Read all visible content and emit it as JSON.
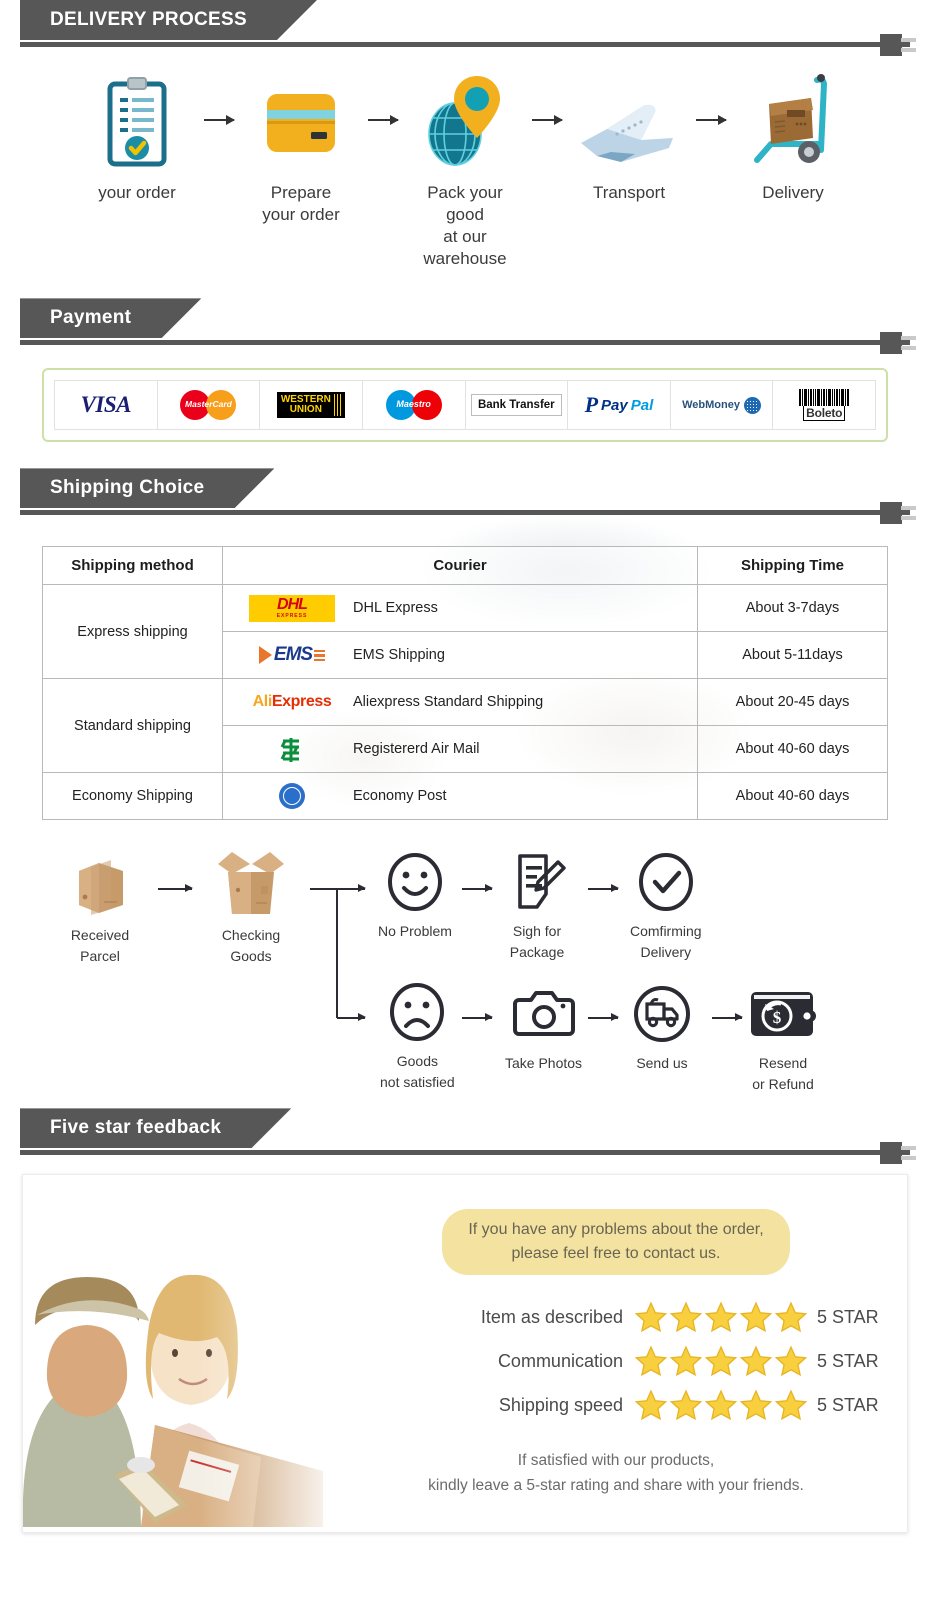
{
  "sections": {
    "delivery_process": {
      "title": "DELIVERY PROCESS"
    },
    "payment": {
      "title": "Payment"
    },
    "shipping_choice": {
      "title": "Shipping Choice"
    },
    "five_star": {
      "title": "Five star feedback"
    }
  },
  "process": {
    "steps": [
      {
        "icon": "clipboard-check-icon",
        "label": "your order"
      },
      {
        "icon": "credit-card-icon",
        "label": "Prepare\nyour order"
      },
      {
        "icon": "globe-location-pin-icon",
        "label": "Pack your good\nat our warehouse"
      },
      {
        "icon": "airplane-icon",
        "label": "Transport"
      },
      {
        "icon": "hand-truck-box-icon",
        "label": "Delivery"
      }
    ],
    "arrow_icon": "arrow-right-icon"
  },
  "payment_methods": [
    {
      "name": "VISA",
      "icon": "visa-logo"
    },
    {
      "name": "MasterCard",
      "icon": "mastercard-logo"
    },
    {
      "name": "WESTERN UNION",
      "icon": "western-union-logo"
    },
    {
      "name": "Maestro",
      "icon": "maestro-logo"
    },
    {
      "name": "Bank Transfer",
      "icon": "bank-transfer-logo"
    },
    {
      "name": "PayPal",
      "icon": "paypal-logo"
    },
    {
      "name": "WebMoney",
      "icon": "webmoney-logo"
    },
    {
      "name": "Boleto",
      "icon": "boleto-logo"
    }
  ],
  "shipping_table": {
    "headers": [
      "Shipping method",
      "Courier",
      "Shipping Time"
    ],
    "rows": [
      {
        "method": "Express shipping",
        "method_rowspan": 2,
        "logo": "dhl-logo",
        "courier": "DHL Express",
        "time": "About 3-7days"
      },
      {
        "method": "",
        "method_rowspan": 0,
        "logo": "ems-logo",
        "courier": "EMS Shipping",
        "time": "About 5-11days"
      },
      {
        "method": "Standard shipping",
        "method_rowspan": 2,
        "logo": "aliexpress-logo",
        "courier": "Aliexpress Standard Shipping",
        "time": "About 20-45 days"
      },
      {
        "method": "",
        "method_rowspan": 0,
        "logo": "china-post-logo",
        "courier": "Registererd Air Mail",
        "time": "About 40-60 days"
      },
      {
        "method": "Economy Shipping",
        "method_rowspan": 1,
        "logo": "un-post-logo",
        "courier": "Economy Post",
        "time": "About 40-60 days"
      }
    ]
  },
  "flow": {
    "start": [
      {
        "icon": "closed-parcel-icon",
        "label": "Received\nParcel"
      },
      {
        "icon": "open-box-icon",
        "label": "Checking\nGoods"
      }
    ],
    "happy_path": [
      {
        "icon": "smiley-face-icon",
        "label": "No Problem"
      },
      {
        "icon": "sign-document-icon",
        "label": "Sigh for\nPackage"
      },
      {
        "icon": "check-circle-icon",
        "label": "Comfirming\nDelivery"
      }
    ],
    "sad_path": [
      {
        "icon": "sad-face-icon",
        "label": "Goods\nnot satisfied"
      },
      {
        "icon": "camera-icon",
        "label": "Take Photos"
      },
      {
        "icon": "delivery-truck-circle-icon",
        "label": "Send us"
      },
      {
        "icon": "wallet-refund-icon",
        "label": "Resend\nor Refund"
      }
    ]
  },
  "feedback": {
    "photo_alt": "courier-handing-parcel-photo",
    "bubble": "If you have any problems about the order,\nplease feel free to contact us.",
    "ratings": [
      {
        "label": "Item as described",
        "stars": 5,
        "value": "5 STAR"
      },
      {
        "label": "Communication",
        "stars": 5,
        "value": "5 STAR"
      },
      {
        "label": "Shipping speed",
        "stars": 5,
        "value": "5 STAR"
      }
    ],
    "footer": "If satisfied with our products,\nkindly leave a 5-star rating and share with your friends."
  },
  "colors": {
    "banner": "#575757",
    "payment_border": "#cde0a8",
    "bubble": "#f3e2a0",
    "star": "#f5c528",
    "accent_teal": "#1b9aaa",
    "accent_yellow": "#f2b01e"
  }
}
